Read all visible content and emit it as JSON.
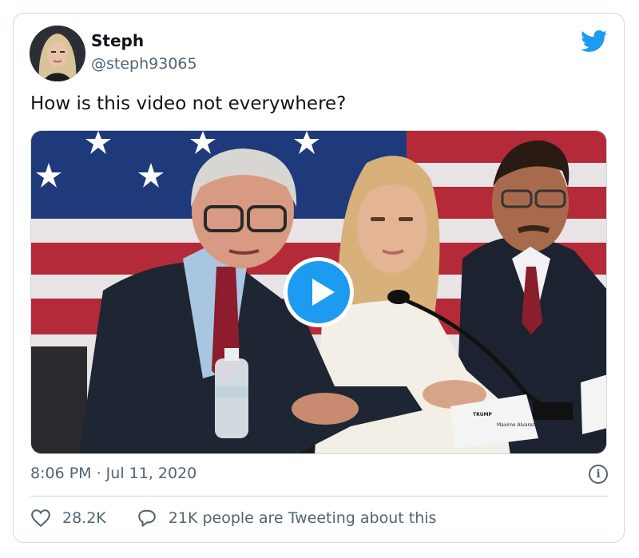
{
  "author": {
    "name": "Steph",
    "handle": "@steph93065"
  },
  "tweet": {
    "text": "How is this video not everywhere?",
    "timestamp": "8:06 PM · Jul 11, 2020"
  },
  "media": {
    "type": "video",
    "nameplate_text": "Maximo Alvarez"
  },
  "actions": {
    "likes": "28.2K",
    "tweeting": "21K people are Tweeting about this"
  },
  "icons": {
    "brand": "twitter-bird-icon",
    "info": "info-icon",
    "like": "heart-icon",
    "reply": "speech-bubble-icon",
    "play": "play-icon"
  },
  "colors": {
    "twitter_blue": "#1d9bf0",
    "secondary_text": "#536471",
    "border": "#cfd9de"
  }
}
